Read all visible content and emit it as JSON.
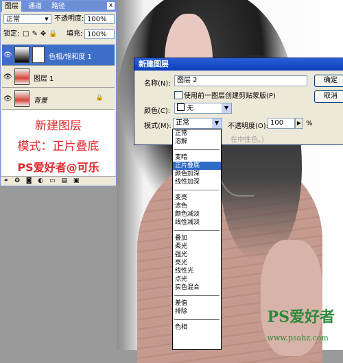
{
  "layers_panel": {
    "tabs": [
      "图层",
      "通道",
      "路径"
    ],
    "close": "x",
    "blend_mode": "正常",
    "opacity_label": "不透明度:",
    "opacity_value": "100%",
    "lock_label": "锁定:",
    "fill_label": "填充:",
    "fill_value": "100%",
    "layers": [
      {
        "name": "色相/饱和度 1"
      },
      {
        "name": "图层 1"
      },
      {
        "name": "背景"
      }
    ],
    "promo": {
      "line1": "新建图层",
      "line2": "模式：正片叠底",
      "line3": "PS爱好者@可乐"
    },
    "bottom_icons": "⚭ ❂ ◙ ◐ ▭ ▤ ▣"
  },
  "dialog": {
    "title": "新建图层",
    "name_label": "名称(N):",
    "name_value": "图层 2",
    "clip_label": "使用前一图层创建剪贴蒙版(P)",
    "color_label": "颜色(C):",
    "color_value": "无",
    "mode_label": "模式(M):",
    "mode_value": "正常",
    "opacity_label": "不透明度(O):",
    "opacity_value": "100",
    "opacity_unit": "%",
    "neutral_hint": "在中性色。)",
    "ok_label": "确定",
    "cancel_label": "取消"
  },
  "dropdown": {
    "groups": [
      [
        "正常",
        "溶解"
      ],
      [
        "变暗",
        "正片叠底",
        "颜色加深",
        "线性加深"
      ],
      [
        "变亮",
        "滤色",
        "颜色减淡",
        "线性减淡"
      ],
      [
        "叠加",
        "柔光",
        "强光",
        "亮光",
        "线性光",
        "点光",
        "实色混合"
      ],
      [
        "差值",
        "排除"
      ],
      [
        "色相"
      ]
    ],
    "highlighted": "正片叠底"
  },
  "watermark": {
    "logo": "PS",
    "text": "爱好者",
    "url": "www.psahz.com"
  }
}
